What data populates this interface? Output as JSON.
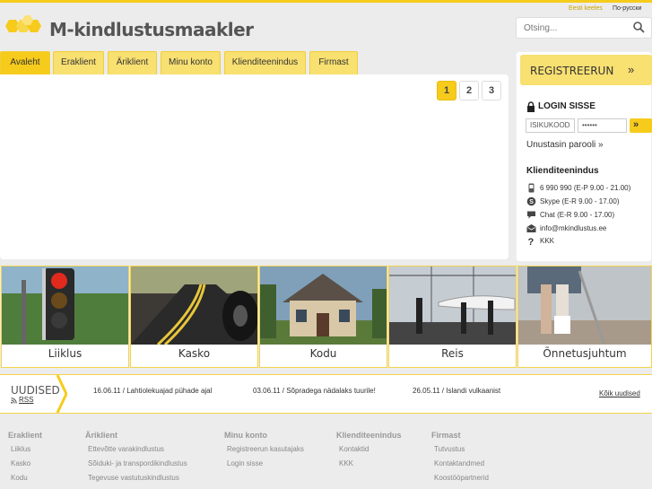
{
  "header": {
    "lang_estonian": "Eesti keeles",
    "lang_russian": "По-русски",
    "logo_text": "M-kindlustusmaakler",
    "search_placeholder": "Otsing..."
  },
  "nav": {
    "tabs": [
      {
        "label": "Avaleht",
        "active": true
      },
      {
        "label": "Eraklient",
        "active": false
      },
      {
        "label": "Äriklient",
        "active": false
      },
      {
        "label": "Minu konto",
        "active": false
      },
      {
        "label": "Klienditeenindus",
        "active": false
      },
      {
        "label": "Firmast",
        "active": false
      }
    ]
  },
  "slider": {
    "pages": [
      "1",
      "2",
      "3"
    ],
    "active_page": "1"
  },
  "sidebar": {
    "register_label": "REGISTREERUN",
    "login_title": "LOGIN SISSE",
    "id_placeholder": "ISIKUKOOD",
    "password_value": "••••••",
    "forgot_label": "Unustasin parooli »",
    "service_title": "Klienditeenindus",
    "service_items": [
      {
        "icon": "phone-icon",
        "text": "6 990 990 (E-P 9.00 - 21.00)"
      },
      {
        "icon": "skype-icon",
        "text": "Skype (E-R 9.00 - 17.00)"
      },
      {
        "icon": "chat-icon",
        "text": "Chat (E-R 9.00 - 17.00)"
      },
      {
        "icon": "mail-icon",
        "text": "info@mkindlustus.ee"
      },
      {
        "icon": "question-icon",
        "text": "KKK"
      }
    ]
  },
  "tiles": [
    {
      "label": "Liiklus",
      "image": "traffic-light"
    },
    {
      "label": "Kasko",
      "image": "road"
    },
    {
      "label": "Kodu",
      "image": "house"
    },
    {
      "label": "Reis",
      "image": "airport"
    },
    {
      "label": "Õnnetusjuhtum",
      "image": "crutches"
    }
  ],
  "news": {
    "title": "UUDISED",
    "rss_label": "RSS",
    "items": [
      "16.06.11 / Lahtiolekuajad pühade ajal",
      "03.06.11 / Sõpradega nädalaks tuurile!",
      "26.05.11 / Islandi vulkaanist"
    ],
    "all_label": "Kõik uudised"
  },
  "footer": [
    {
      "title": "Eraklient",
      "links": [
        "Liiklus",
        "Kasko",
        "Kodu"
      ]
    },
    {
      "title": "Äriklient",
      "links": [
        "Ettevõtte varakindlustus",
        "Sõiduki- ja transpordikindlustus",
        "Tegevuse vastutuskindlustus"
      ]
    },
    {
      "title": "Minu konto",
      "links": [
        "Registreerun kasutajaks",
        "Login sisse"
      ]
    },
    {
      "title": "Klienditeenindus",
      "links": [
        "Kontaktid",
        "KKK"
      ]
    },
    {
      "title": "Firmast",
      "links": [
        "Tutvustus",
        "Kontaktandmed",
        "Koostööpartnerid"
      ]
    }
  ],
  "colors": {
    "accent": "#f6cb1b",
    "accent_light": "#f8e071",
    "background": "#ececec"
  }
}
